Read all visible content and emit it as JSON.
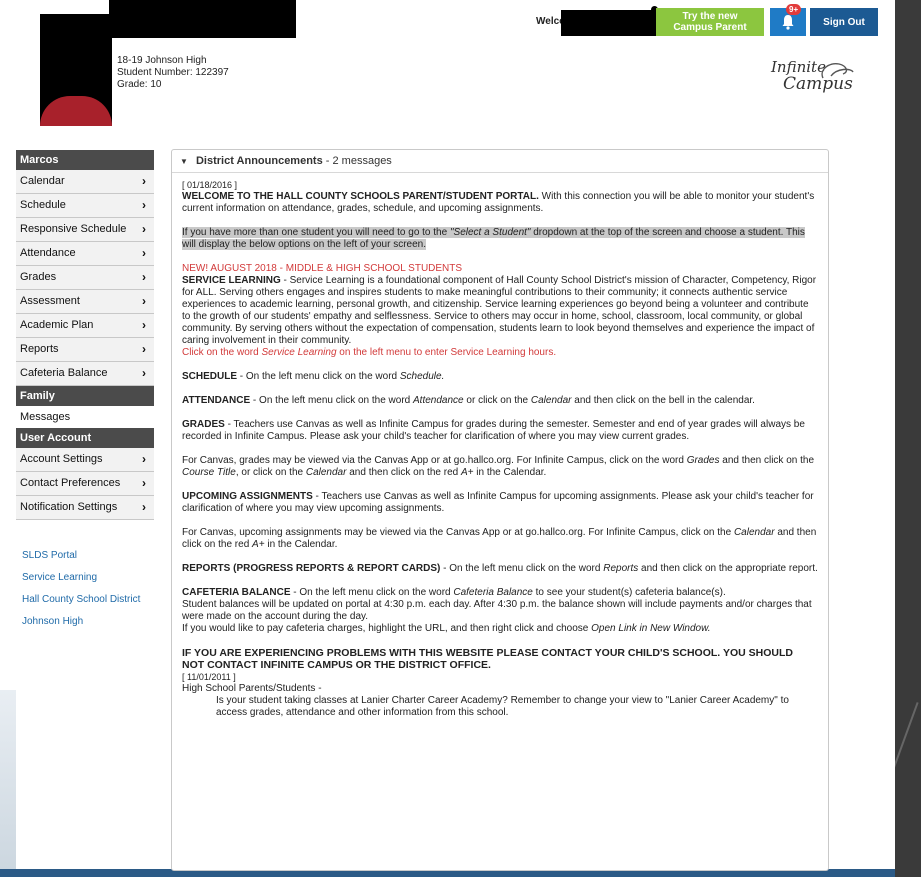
{
  "header": {
    "student_info_line1": "18-19 Johnson High",
    "student_info_line2": "Student Number: 122397",
    "student_info_line3": "Grade: 10",
    "welcome": "Welcome",
    "campus_parent_button": "Try the new Campus Parent",
    "notification_badge": "9+",
    "signout_button": "Sign Out",
    "logo_line1": "Infinite",
    "logo_line2": "Campus"
  },
  "sidebar": {
    "section1": "Marcos",
    "items1": [
      {
        "label": "Calendar"
      },
      {
        "label": "Schedule"
      },
      {
        "label": "Responsive Schedule"
      },
      {
        "label": "Attendance"
      },
      {
        "label": "Grades"
      },
      {
        "label": "Assessment"
      },
      {
        "label": "Academic Plan"
      },
      {
        "label": "Reports"
      },
      {
        "label": "Cafeteria Balance"
      }
    ],
    "section2": "Family",
    "messages": "Messages",
    "section3": "User Account",
    "items3": [
      {
        "label": "Account Settings"
      },
      {
        "label": "Contact Preferences"
      },
      {
        "label": "Notification Settings"
      }
    ],
    "links": [
      "SLDS Portal",
      "Service Learning",
      "Hall County School District",
      "Johnson High"
    ]
  },
  "panel": {
    "title": "District Announcements",
    "count": "- 2 messages",
    "date1": "[ 01/18/2016 ]",
    "welcome_bold": "WELCOME TO THE HALL COUNTY SCHOOLS PARENT/STUDENT PORTAL.",
    "welcome_text": "With this connection you will be able to monitor your student's current information on attendance, grades, schedule, and upcoming assignments.",
    "multi_pre": "If you have more than one student you will need to go to the ",
    "multi_em": "\"Select a Student\"",
    "multi_post": " dropdown at the top of the screen and choose a student.  This will display the below options on the left of your screen.",
    "new_heading": "NEW! AUGUST 2018 - MIDDLE & HIGH SCHOOL STUDENTS",
    "service_bold": "SERVICE LEARNING",
    "service_text": " - Service Learning is a foundational component of Hall County School District's mission of Character, Competency, Rigor for ALL. Serving others engages and inspires students to make meaningful contributions to their community; it connects authentic service experiences to academic learning, personal growth, and citizenship. Service learning experiences go beyond being a volunteer and contribute to the growth of our students' empathy and selflessness. Service to others may occur in home, school, classroom, local community, or global community. By serving others without the expectation of compensation, students learn to look beyond themselves and experience the impact of caring involvement in their community.",
    "service_click_pre": "Click on the word ",
    "service_click_em": "Service Learning",
    "service_click_post": " on the left menu to enter Service Learning hours.",
    "schedule_bold": "SCHEDULE",
    "schedule_text": " - On the left menu click on the word ",
    "schedule_em": "Schedule.",
    "att_bold": "ATTENDANCE",
    "att_text1": " - On the left menu click on the word ",
    "att_em1": "Attendance",
    "att_text2": " or click on the ",
    "att_em2": "Calendar",
    "att_text3": " and then click on the bell in the calendar.",
    "grades_bold": "GRADES",
    "grades_text": " - Teachers use Canvas as well as Infinite Campus for grades during the semester. Semester and end of year grades will always be recorded in Infinite Campus. Please ask your child's teacher for clarification of where you may view current grades.",
    "canvas1_text1": "For Canvas, grades may be viewed via the Canvas App or at go.hallco.org. For Infinite Campus, click on the word ",
    "canvas1_em1": "Grades",
    "canvas1_text2": " and then click on the ",
    "canvas1_em2": "Course Title",
    "canvas1_text3": ", or click on the ",
    "canvas1_em3": "Calendar",
    "canvas1_text4": " and then click on the red ",
    "canvas1_em4": "A+",
    "canvas1_text5": " in the Calendar.",
    "upc_bold": "UPCOMING ASSIGNMENTS",
    "upc_text": " - Teachers use Canvas as well as Infinite Campus for upcoming assignments.  Please ask your child's teacher for clarification of where you may view upcoming assignments.",
    "canvas2_text1": "For Canvas, upcoming assignments may be viewed via the Canvas App or at go.hallco.org.  For Infinite Campus, click on the ",
    "canvas2_em1": "Calendar",
    "canvas2_text2": " and then click on the red ",
    "canvas2_em2": "A+",
    "canvas2_text3": " in the Calendar.",
    "reports_bold": "REPORTS (PROGRESS REPORTS & REPORT CARDS)",
    "reports_text": " - On the left menu click on the word ",
    "reports_em": "Reports",
    "reports_text2": " and then click on the appropriate report.",
    "caf_bold": "CAFETERIA BALANCE",
    "caf_text1": " - On the left menu click on the word ",
    "caf_em": "Cafeteria Balance",
    "caf_text2": " to see your student(s) cafeteria balance(s).",
    "caf_line2": "Student balances will be updated on portal at 4:30 p.m. each day.  After 4:30 p.m. the balance shown will include payments and/or charges that were made on the account during the day.",
    "caf_line3_pre": "If you would like to pay cafeteria charges, highlight the URL, and then right click and choose ",
    "caf_line3_em": "Open Link in New Window.",
    "problems": "IF YOU ARE EXPERIENCING PROBLEMS WITH THIS WEBSITE PLEASE CONTACT YOUR CHILD'S SCHOOL.  YOU SHOULD NOT CONTACT INFINITE CAMPUS OR THE DISTRICT OFFICE.",
    "date2": "[ 11/01/2011 ]",
    "hs_line": "High School Parents/Students -",
    "lanier": "Is your student taking classes at Lanier Charter Career Academy?  Remember to change your view to \"Lanier Career Academy\" to access grades, attendance and other information from this school."
  },
  "colors": {
    "green": "#8cc63f",
    "blue": "#1f7bc6",
    "dark_blue": "#1c5a93",
    "sidebar_header": "#4b4b4b",
    "red_text": "#d23a3a",
    "link": "#1f6aa8"
  }
}
